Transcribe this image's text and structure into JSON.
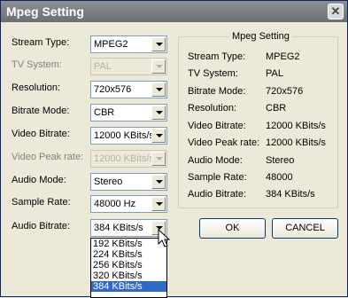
{
  "window": {
    "title": "Mpeg Setting",
    "close_glyph": "✕"
  },
  "fields": [
    {
      "label": "Stream Type:",
      "value": "MPEG2",
      "disabled": false
    },
    {
      "label": "TV System:",
      "value": "PAL",
      "disabled": true
    },
    {
      "label": "Resolution:",
      "value": "720x576",
      "disabled": false
    },
    {
      "label": "Bitrate Mode:",
      "value": "CBR",
      "disabled": false
    },
    {
      "label": "Video Bitrate:",
      "value": "12000 KBits/s",
      "disabled": false
    },
    {
      "label": "Video Peak rate:",
      "value": "12000 KBits/s",
      "disabled": true
    },
    {
      "label": "Audio Mode:",
      "value": "Stereo",
      "disabled": false
    },
    {
      "label": "Sample Rate:",
      "value": "48000 Hz",
      "disabled": false
    },
    {
      "label": "Audio Bitrate:",
      "value": "384 KBits/s",
      "disabled": false
    }
  ],
  "summary": {
    "title": "Mpeg Setting",
    "rows": [
      {
        "key": "Stream Type:",
        "value": "MPEG2"
      },
      {
        "key": "TV System:",
        "value": "PAL"
      },
      {
        "key": "Bitrate Mode:",
        "value": "720x576"
      },
      {
        "key": "Resolution:",
        "value": "CBR"
      },
      {
        "key": "Video Bitrate:",
        "value": "12000 KBits/s"
      },
      {
        "key": "Video Peak rate:",
        "value": "12000 KBits/s"
      },
      {
        "key": "Audio Mode:",
        "value": "Stereo"
      },
      {
        "key": "Sample Rate:",
        "value": "48000"
      },
      {
        "key": "Audio Bitrate:",
        "value": "384 KBits/s"
      }
    ]
  },
  "buttons": {
    "ok": "OK",
    "cancel": "CANCEL"
  },
  "audio_bitrate_options": [
    "192 KBits/s",
    "224 KBits/s",
    "256 KBits/s",
    "320 KBits/s",
    "384 KBits/s"
  ],
  "selected_option": "384 KBits/s"
}
